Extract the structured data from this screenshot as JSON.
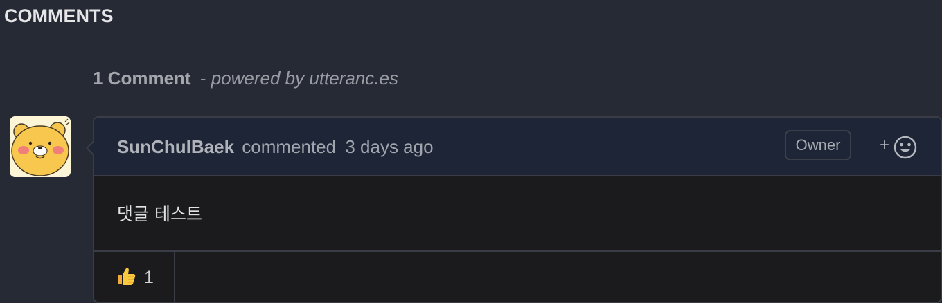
{
  "section": {
    "title": "COMMENTS"
  },
  "thread": {
    "count_label": "1 Comment",
    "separator": "-",
    "powered_by": "powered by utteranc.es"
  },
  "comment": {
    "author": "SunChulBaek",
    "action": "commented",
    "time": "3 days ago",
    "badge": "Owner",
    "add_reaction_label": "+",
    "body": "댓글 테스트",
    "avatar_icon": "yellow-bear-avatar-icon",
    "reactions": [
      {
        "icon": "thumbs-up-icon",
        "count": "1"
      }
    ]
  },
  "colors": {
    "background": "#262a34",
    "header_background": "#1d2536",
    "body_background": "#1b1b1d",
    "border": "#3a3d45"
  }
}
